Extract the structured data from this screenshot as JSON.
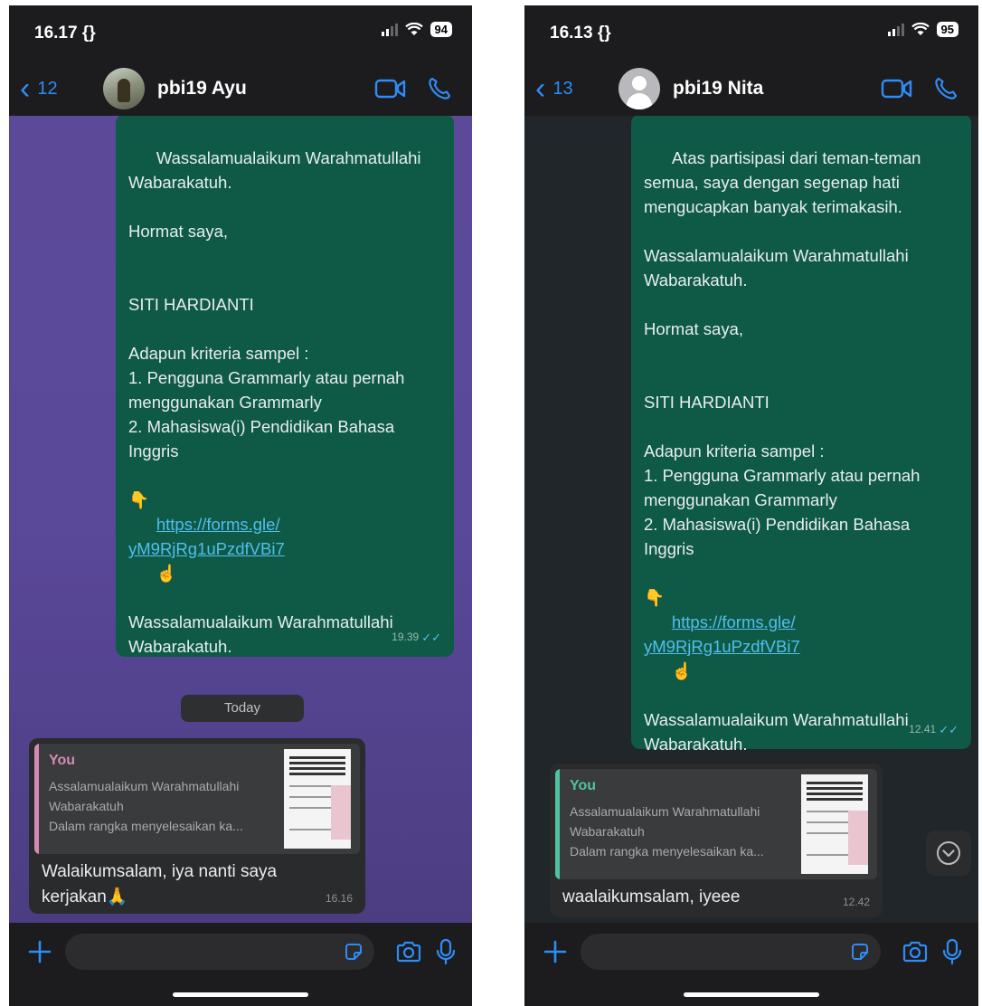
{
  "screens": [
    {
      "status_time": "16.17 {}",
      "battery": "94",
      "back_count": "12",
      "contact_name": "pbi19 Ayu",
      "message": {
        "text_before_link": "Wassalamualaikum Warahmatullahi\nWabarakatuh.\n\nHormat saya,\n\n\nSITI HARDIANTI\n\nAdapun kriteria sampel :\n1. Pengguna Grammarly atau pernah menggunakan Grammarly\n2. Mahasiswa(i) Pendidikan Bahasa Inggris\n\n👇",
        "link": "https://forms.gle/\nyM9RjRg1uPzdfVBi7",
        "text_after_link": "☝\n\nWassalamualaikum Warahmatullahi\nWabarakatuh.",
        "time": "19.39"
      },
      "date_chip": "Today",
      "reply": {
        "quote_author": "You",
        "quote_text": "Assalamualaikum Warahmatullahi\nWabarakatuh\nDalam rangka menyelesaikan ka...",
        "text": "Walaikumsalam, iya nanti saya\nkerjakan🙏",
        "time": "16.16"
      },
      "colors": {
        "quote_bar": "#d48bb3"
      }
    },
    {
      "status_time": "16.13 {}",
      "battery": "95",
      "back_count": "13",
      "contact_name": "pbi19 Nita",
      "message": {
        "text_before_link": "Atas partisipasi dari teman-teman semua, saya dengan segenap hati mengucapkan banyak terimakasih.\n\nWassalamualaikum Warahmatullahi\nWabarakatuh.\n\nHormat saya,\n\n\nSITI HARDIANTI\n\nAdapun kriteria sampel :\n1. Pengguna Grammarly atau pernah menggunakan Grammarly\n2. Mahasiswa(i) Pendidikan Bahasa Inggris\n\n👇",
        "link": "https://forms.gle/\nyM9RjRg1uPzdfVBi7",
        "text_after_link": "☝\n\nWassalamualaikum Warahmatullahi\nWabarakatuh.",
        "time": "12.41"
      },
      "reply": {
        "quote_author": "You",
        "quote_text": "Assalamualaikum Warahmatullahi\nWabarakatuh\nDalam rangka menyelesaikan ka...",
        "text": "waalaikumsalam, iyeee",
        "time": "12.42"
      },
      "colors": {
        "quote_bar": "#4fc3a1"
      }
    }
  ],
  "icons": {
    "back": "chevron-left-icon",
    "video": "video-camera-icon",
    "call": "phone-icon",
    "plus": "plus-icon",
    "sticker": "sticker-icon",
    "camera": "camera-icon",
    "mic": "microphone-icon",
    "scroll": "chevron-down-icon"
  },
  "colors": {
    "accent": "#2f8cf6",
    "outgoing_bubble": "#0e5a47",
    "incoming_bubble": "#2a2b2c",
    "link": "#53bdeb",
    "wallpaper_left": "#5c4a99",
    "wallpaper_right": "#20262a"
  }
}
